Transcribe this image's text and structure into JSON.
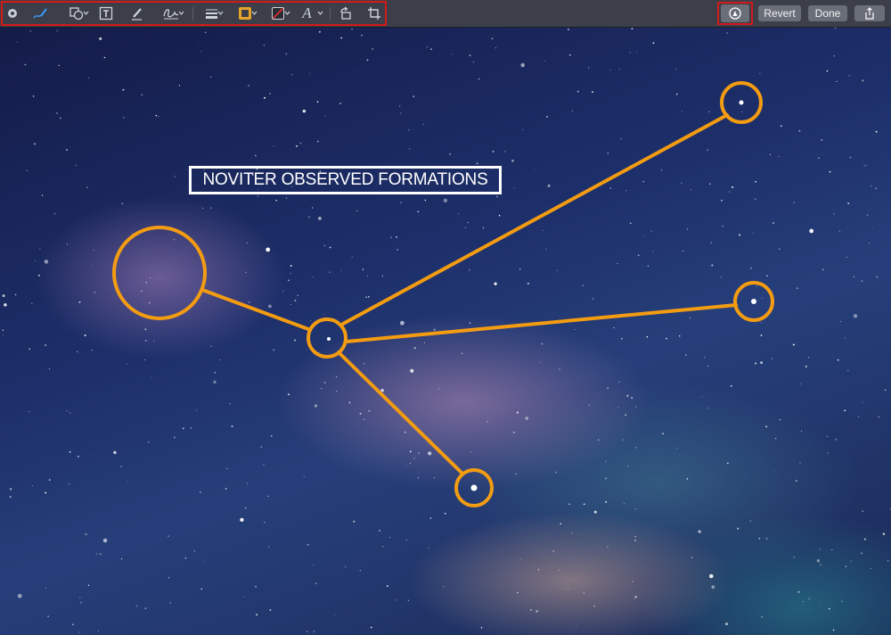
{
  "toolbar": {
    "tools": [
      {
        "id": "sketch",
        "icon": "sketch-pen-icon",
        "has_menu": false
      },
      {
        "id": "shapes",
        "icon": "shapes-icon",
        "has_menu": true
      },
      {
        "id": "text",
        "icon": "text-box-icon",
        "has_menu": false
      },
      {
        "id": "highlight",
        "icon": "highlighter-icon",
        "has_menu": false
      },
      {
        "id": "sign",
        "icon": "signature-icon",
        "has_menu": true
      },
      {
        "id": "line-style",
        "icon": "line-style-icon",
        "has_menu": true
      },
      {
        "id": "border-color",
        "icon": "border-color-icon",
        "has_menu": true,
        "color": "#f39c12"
      },
      {
        "id": "fill-color",
        "icon": "fill-color-icon",
        "has_menu": true,
        "color": "#e02d2d"
      },
      {
        "id": "text-style",
        "icon": "text-style-icon",
        "has_menu": true,
        "glyph": "A"
      },
      {
        "id": "rotate",
        "icon": "rotate-left-icon",
        "has_menu": false
      },
      {
        "id": "crop",
        "icon": "crop-icon",
        "has_menu": false
      }
    ],
    "revert_label": "Revert",
    "done_label": "Done"
  },
  "canvas": {
    "caption": "NOVITER OBSERVED FORMATIONS",
    "annotation_color": "#f39c12"
  }
}
